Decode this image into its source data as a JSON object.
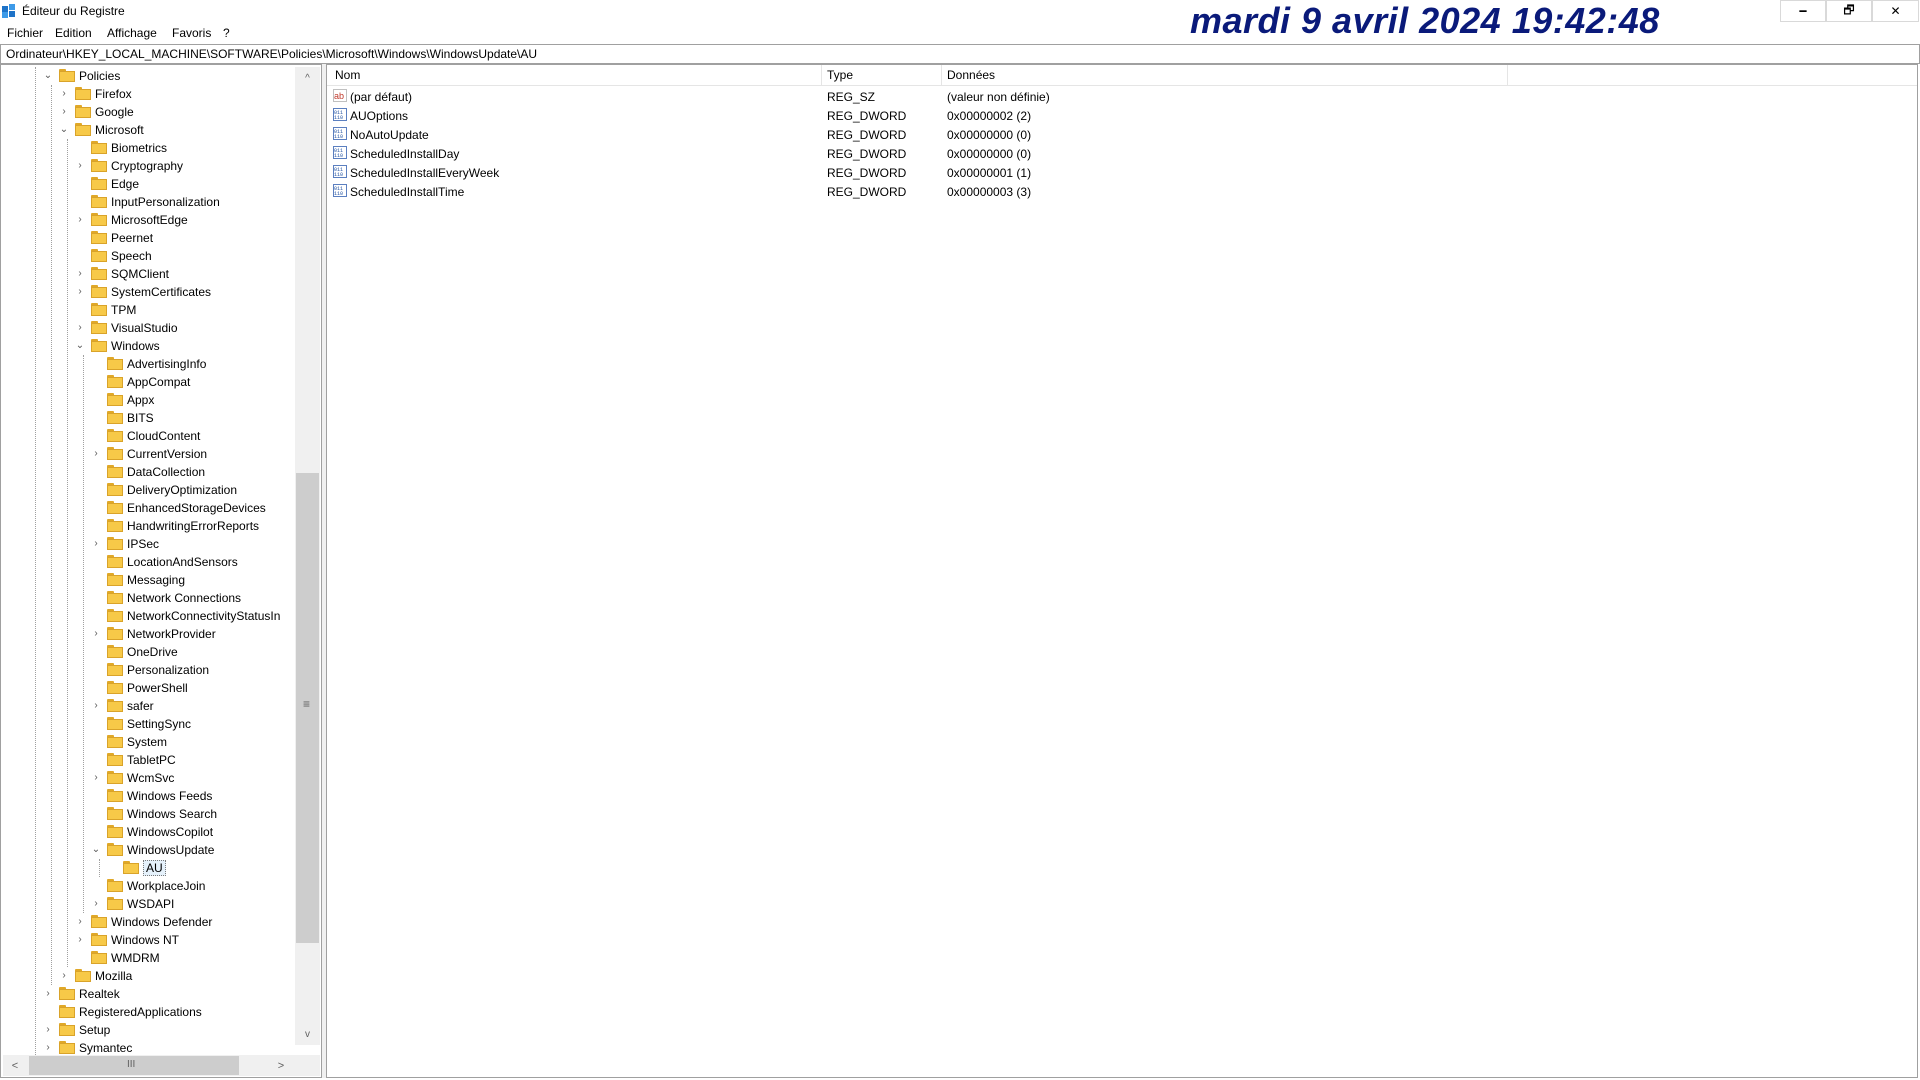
{
  "window": {
    "title": "Éditeur du Registre",
    "clock": "mardi 9 avril 2024 19:42:48",
    "minimize_label": "🗕",
    "maximize_label": "🗗",
    "close_label": "✕"
  },
  "menu": [
    "Fichier",
    "Edition",
    "Affichage",
    "Favoris",
    "?"
  ],
  "address": "Ordinateur\\HKEY_LOCAL_MACHINE\\SOFTWARE\\Policies\\Microsoft\\Windows\\WindowsUpdate\\AU",
  "tree": [
    {
      "label": "Policies",
      "level": 0,
      "expander": "open"
    },
    {
      "label": "Firefox",
      "level": 1,
      "expander": "closed"
    },
    {
      "label": "Google",
      "level": 1,
      "expander": "closed"
    },
    {
      "label": "Microsoft",
      "level": 1,
      "expander": "open"
    },
    {
      "label": "Biometrics",
      "level": 2,
      "expander": ""
    },
    {
      "label": "Cryptography",
      "level": 2,
      "expander": "closed"
    },
    {
      "label": "Edge",
      "level": 2,
      "expander": ""
    },
    {
      "label": "InputPersonalization",
      "level": 2,
      "expander": ""
    },
    {
      "label": "MicrosoftEdge",
      "level": 2,
      "expander": "closed"
    },
    {
      "label": "Peernet",
      "level": 2,
      "expander": ""
    },
    {
      "label": "Speech",
      "level": 2,
      "expander": ""
    },
    {
      "label": "SQMClient",
      "level": 2,
      "expander": "closed"
    },
    {
      "label": "SystemCertificates",
      "level": 2,
      "expander": "closed"
    },
    {
      "label": "TPM",
      "level": 2,
      "expander": ""
    },
    {
      "label": "VisualStudio",
      "level": 2,
      "expander": "closed"
    },
    {
      "label": "Windows",
      "level": 2,
      "expander": "open"
    },
    {
      "label": "AdvertisingInfo",
      "level": 3,
      "expander": ""
    },
    {
      "label": "AppCompat",
      "level": 3,
      "expander": ""
    },
    {
      "label": "Appx",
      "level": 3,
      "expander": ""
    },
    {
      "label": "BITS",
      "level": 3,
      "expander": ""
    },
    {
      "label": "CloudContent",
      "level": 3,
      "expander": ""
    },
    {
      "label": "CurrentVersion",
      "level": 3,
      "expander": "closed"
    },
    {
      "label": "DataCollection",
      "level": 3,
      "expander": ""
    },
    {
      "label": "DeliveryOptimization",
      "level": 3,
      "expander": ""
    },
    {
      "label": "EnhancedStorageDevices",
      "level": 3,
      "expander": ""
    },
    {
      "label": "HandwritingErrorReports",
      "level": 3,
      "expander": ""
    },
    {
      "label": "IPSec",
      "level": 3,
      "expander": "closed"
    },
    {
      "label": "LocationAndSensors",
      "level": 3,
      "expander": ""
    },
    {
      "label": "Messaging",
      "level": 3,
      "expander": ""
    },
    {
      "label": "Network Connections",
      "level": 3,
      "expander": ""
    },
    {
      "label": "NetworkConnectivityStatusIn",
      "level": 3,
      "expander": ""
    },
    {
      "label": "NetworkProvider",
      "level": 3,
      "expander": "closed"
    },
    {
      "label": "OneDrive",
      "level": 3,
      "expander": ""
    },
    {
      "label": "Personalization",
      "level": 3,
      "expander": ""
    },
    {
      "label": "PowerShell",
      "level": 3,
      "expander": ""
    },
    {
      "label": "safer",
      "level": 3,
      "expander": "closed"
    },
    {
      "label": "SettingSync",
      "level": 3,
      "expander": ""
    },
    {
      "label": "System",
      "level": 3,
      "expander": ""
    },
    {
      "label": "TabletPC",
      "level": 3,
      "expander": ""
    },
    {
      "label": "WcmSvc",
      "level": 3,
      "expander": "closed"
    },
    {
      "label": "Windows Feeds",
      "level": 3,
      "expander": ""
    },
    {
      "label": "Windows Search",
      "level": 3,
      "expander": ""
    },
    {
      "label": "WindowsCopilot",
      "level": 3,
      "expander": ""
    },
    {
      "label": "WindowsUpdate",
      "level": 3,
      "expander": "open"
    },
    {
      "label": "AU",
      "level": 4,
      "expander": "",
      "selected": true
    },
    {
      "label": "WorkplaceJoin",
      "level": 3,
      "expander": ""
    },
    {
      "label": "WSDAPI",
      "level": 3,
      "expander": "closed"
    },
    {
      "label": "Windows Defender",
      "level": 2,
      "expander": "closed"
    },
    {
      "label": "Windows NT",
      "level": 2,
      "expander": "closed"
    },
    {
      "label": "WMDRM",
      "level": 2,
      "expander": ""
    },
    {
      "label": "Mozilla",
      "level": 1,
      "expander": "closed"
    },
    {
      "label": "Realtek",
      "level": 0,
      "expander": "closed"
    },
    {
      "label": "RegisteredApplications",
      "level": 0,
      "expander": ""
    },
    {
      "label": "Setup",
      "level": 0,
      "expander": "closed"
    },
    {
      "label": "Symantec",
      "level": 0,
      "expander": "closed"
    }
  ],
  "columns": {
    "name": "Nom",
    "type": "Type",
    "data": "Données"
  },
  "values": [
    {
      "icon": "string-value-icon",
      "name": "(par défaut)",
      "type": "REG_SZ",
      "data": "(valeur non définie)"
    },
    {
      "icon": "binary-value-icon",
      "name": "AUOptions",
      "type": "REG_DWORD",
      "data": "0x00000002 (2)"
    },
    {
      "icon": "binary-value-icon",
      "name": "NoAutoUpdate",
      "type": "REG_DWORD",
      "data": "0x00000000 (0)"
    },
    {
      "icon": "binary-value-icon",
      "name": "ScheduledInstallDay",
      "type": "REG_DWORD",
      "data": "0x00000000 (0)"
    },
    {
      "icon": "binary-value-icon",
      "name": "ScheduledInstallEveryWeek",
      "type": "REG_DWORD",
      "data": "0x00000001 (1)"
    },
    {
      "icon": "binary-value-icon",
      "name": "ScheduledInstallTime",
      "type": "REG_DWORD",
      "data": "0x00000003 (3)"
    }
  ],
  "scroll": {
    "up": "^",
    "down": "v",
    "left": "<",
    "right": ">",
    "grip": "≡",
    "hgrip": "III"
  },
  "colors": {
    "clock": "#0a1a7a",
    "folder": "#f7c948",
    "selection": "#e5f1fb"
  }
}
